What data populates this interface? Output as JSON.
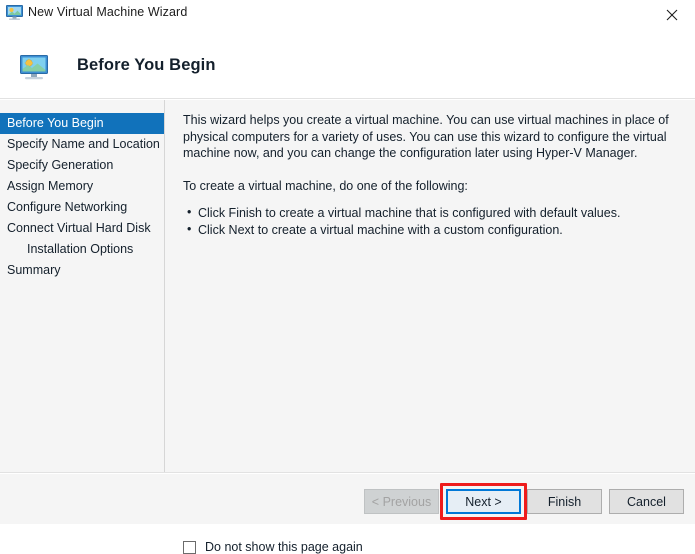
{
  "window": {
    "title": "New Virtual Machine Wizard",
    "title_icon": "virtual-machine-monitor-icon",
    "close_label": "✕"
  },
  "header": {
    "title": "Before You Begin",
    "icon": "virtual-machine-monitor-icon"
  },
  "sidebar": {
    "items": [
      {
        "label": "Before You Begin",
        "selected": true,
        "indented": false
      },
      {
        "label": "Specify Name and Location",
        "selected": false,
        "indented": false
      },
      {
        "label": "Specify Generation",
        "selected": false,
        "indented": false
      },
      {
        "label": "Assign Memory",
        "selected": false,
        "indented": false
      },
      {
        "label": "Configure Networking",
        "selected": false,
        "indented": false
      },
      {
        "label": "Connect Virtual Hard Disk",
        "selected": false,
        "indented": false
      },
      {
        "label": "Installation Options",
        "selected": false,
        "indented": true
      },
      {
        "label": "Summary",
        "selected": false,
        "indented": false
      }
    ]
  },
  "content": {
    "paragraph1": "This wizard helps you create a virtual machine. You can use virtual machines in place of physical computers for a variety of uses. You can use this wizard to configure the virtual machine now, and you can change the configuration later using Hyper-V Manager.",
    "paragraph2": "To create a virtual machine, do one of the following:",
    "bullets": [
      "Click Finish to create a virtual machine that is configured with default values.",
      "Click Next to create a virtual machine with a custom configuration."
    ]
  },
  "checkbox": {
    "label": "Do not show this page again",
    "checked": false
  },
  "footer": {
    "previous_label": "< Previous",
    "next_label": "Next >",
    "finish_label": "Finish",
    "cancel_label": "Cancel"
  },
  "colors": {
    "accent_blue": "#1172bb",
    "focus_blue": "#0078d7",
    "annotation_red": "#ee1c1c",
    "body_background": "#f5f5f5",
    "button_face": "#e1e1e1"
  }
}
